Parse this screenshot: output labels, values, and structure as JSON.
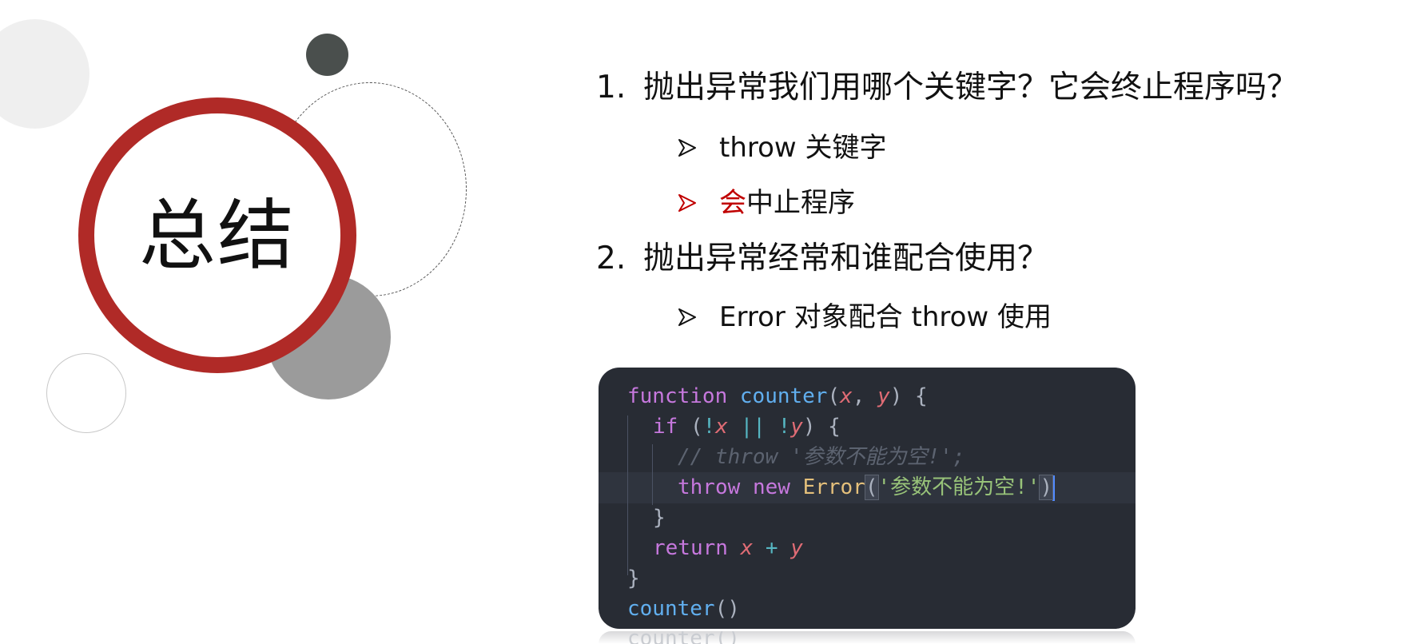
{
  "title": "总结",
  "questions": [
    {
      "number": "1.",
      "text": "抛出异常我们用哪个关键字？它会终止程序吗？",
      "answers": [
        {
          "text": "throw 关键字"
        },
        {
          "highlight": "会",
          "text": "中止程序"
        }
      ]
    },
    {
      "number": "2.",
      "text": "抛出异常经常和谁配合使用？",
      "answers": [
        {
          "text": "Error 对象配合 throw 使用"
        }
      ]
    }
  ],
  "code": {
    "l1": {
      "kw": "function",
      "fn": "counter",
      "a": "x",
      "b": "y"
    },
    "l2": {
      "kw": "if",
      "a": "x",
      "op": "||",
      "b": "y"
    },
    "l3": {
      "comment": "// throw '参数不能为空!';"
    },
    "l4": {
      "kw1": "throw",
      "kw2": "new",
      "cls": "Error",
      "str": "'参数不能为空!'"
    },
    "l6": {
      "kw": "return",
      "a": "x",
      "op": "+",
      "b": "y"
    },
    "l8": {
      "fn": "counter"
    },
    "reflection": "counter()"
  },
  "colors": {
    "accent_red": "#b02a27",
    "highlight_text": "#c00000",
    "code_background": "#282c34"
  },
  "icons": [
    "arrowhead-bullet-icon"
  ]
}
